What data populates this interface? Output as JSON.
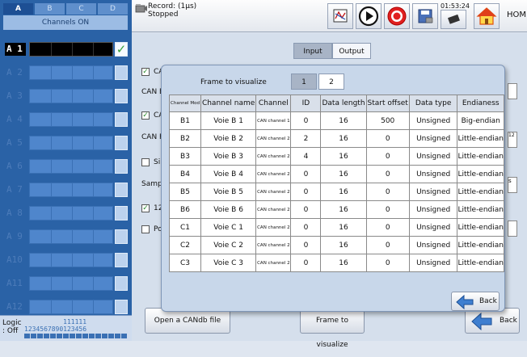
{
  "sidebar": {
    "group_tabs": [
      "A",
      "B",
      "C",
      "D"
    ],
    "channels_on": "Channels ON",
    "channels": [
      {
        "label": "A 1",
        "on": true
      },
      {
        "label": "A 2",
        "on": false
      },
      {
        "label": "A 3",
        "on": false
      },
      {
        "label": "A 4",
        "on": false
      },
      {
        "label": "A 5",
        "on": false
      },
      {
        "label": "A 6",
        "on": false
      },
      {
        "label": "A 7",
        "on": false
      },
      {
        "label": "A 8",
        "on": false
      },
      {
        "label": "A 9",
        "on": false
      },
      {
        "label": "A10",
        "on": false
      },
      {
        "label": "A11",
        "on": false
      },
      {
        "label": "A12",
        "on": false
      }
    ],
    "logic_label": "Logic : Off",
    "logic_digits_top": "          111111",
    "logic_digits_bottom": "1234567890123456"
  },
  "topbar": {
    "record_label": "Record: (1µs)",
    "record_status": "Stopped",
    "clock": "01:53:24",
    "home_label": "HOME"
  },
  "main": {
    "tabs": [
      "Input",
      "Output"
    ],
    "active_tab": "Input",
    "rows": [
      {
        "checked": true,
        "text": "CA"
      },
      {
        "checked": null,
        "text": "CAN E"
      },
      {
        "checked": true,
        "text": "CA"
      },
      {
        "checked": null,
        "text": "CAN F"
      },
      {
        "checked": false,
        "text": "Si"
      },
      {
        "checked": null,
        "text": "Samp"
      },
      {
        "checked": true,
        "text": "12"
      },
      {
        "checked": false,
        "text": "Po"
      }
    ],
    "open_candb_label": "Open a CANdb file",
    "frame_visualize_label": "Frame to visualize",
    "back_label": "Back"
  },
  "dialog": {
    "title": "Frame to visualize",
    "frame_tabs": [
      "1",
      "2"
    ],
    "active_frame": "2",
    "columns": [
      "Channel Mod",
      "Channel name",
      "Channel",
      "ID",
      "Data length",
      "Start offset",
      "Data type",
      "Endianess"
    ],
    "rows": [
      [
        "B1",
        "Voie B 1",
        "CAN channel 1",
        "0",
        "16",
        "500",
        "Unsigned",
        "Big-endian"
      ],
      [
        "B2",
        "Voie B 2",
        "CAN channel 2",
        "2",
        "16",
        "0",
        "Unsigned",
        "Little-endian"
      ],
      [
        "B3",
        "Voie B 3",
        "CAN channel 2",
        "4",
        "16",
        "0",
        "Unsigned",
        "Little-endian"
      ],
      [
        "B4",
        "Voie B 4",
        "CAN channel 2",
        "0",
        "16",
        "0",
        "Unsigned",
        "Little-endian"
      ],
      [
        "B5",
        "Voie B 5",
        "CAN channel 2",
        "0",
        "16",
        "0",
        "Unsigned",
        "Little-endian"
      ],
      [
        "B6",
        "Voie B 6",
        "CAN channel 2",
        "0",
        "16",
        "0",
        "Unsigned",
        "Little-endian"
      ],
      [
        "C1",
        "Voie C 1",
        "CAN channel 2",
        "0",
        "16",
        "0",
        "Unsigned",
        "Little-endian"
      ],
      [
        "C2",
        "Voie C 2",
        "CAN channel 2",
        "0",
        "16",
        "0",
        "Unsigned",
        "Little-endian"
      ],
      [
        "C3",
        "Voie C 3",
        "CAN channel 2",
        "0",
        "16",
        "0",
        "Unsigned",
        "Little-endian"
      ]
    ],
    "back_label": "Back"
  },
  "colors": {
    "sidebar_bg": "#2a62a6",
    "record_red": "#e02020",
    "check_green": "#36a03a",
    "back_arrow_blue": "#3f7fd0"
  },
  "icons": [
    "record-camera-icon",
    "scope-icon",
    "play-icon",
    "record-icon",
    "save-disk-icon",
    "clock-icon",
    "home-icon",
    "back-arrow-icon",
    "checkmark-icon"
  ]
}
